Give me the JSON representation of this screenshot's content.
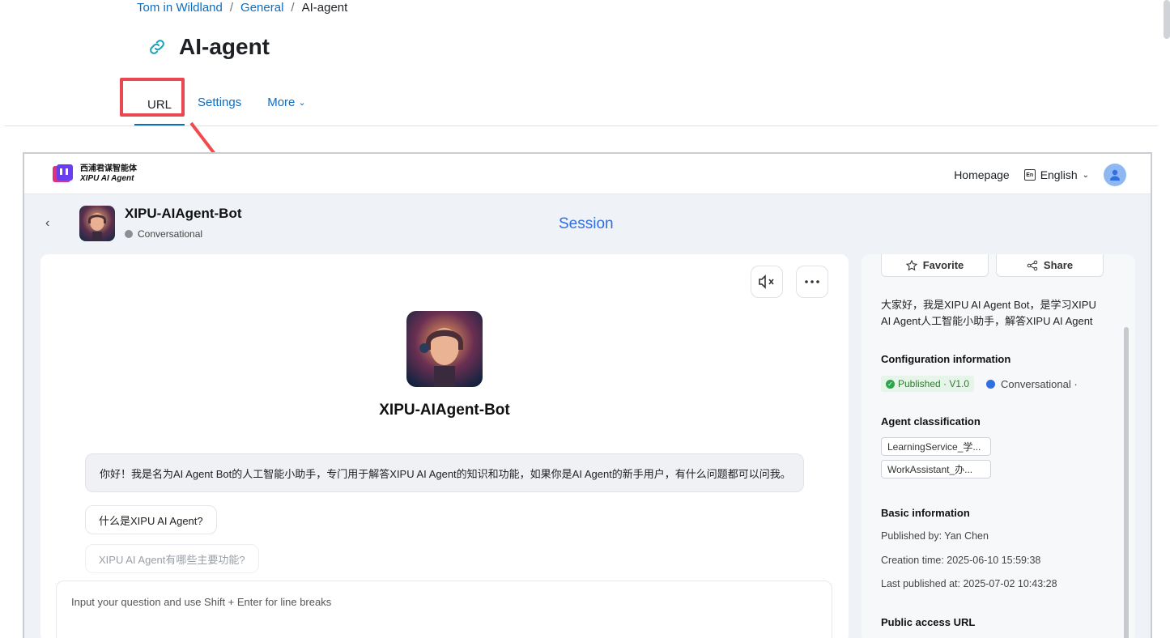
{
  "breadcrumb": {
    "items": [
      "Tom in Wildland",
      "General"
    ],
    "current": "AI-agent",
    "separator": "/"
  },
  "page": {
    "title": "AI-agent",
    "icon": "link-icon"
  },
  "tabs": [
    {
      "label": "URL",
      "active": true
    },
    {
      "label": "Settings",
      "active": false
    },
    {
      "label": "More",
      "active": false,
      "has_dropdown": true
    }
  ],
  "annotation": {
    "highlight_color": "#e8484f"
  },
  "app": {
    "logo": {
      "cn": "西浦君谋智能体",
      "en": "XIPU AI Agent",
      "icon": "xipu-logo-icon"
    },
    "nav": {
      "home": "Homepage",
      "language": "English",
      "language_icon": "language-en-icon",
      "avatar_icon": "user-avatar-icon"
    },
    "bot": {
      "name": "XIPU-AIAgent-Bot",
      "type": "Conversational"
    },
    "session_title": "Session",
    "chat": {
      "bot_name": "XIPU-AIAgent-Bot",
      "greeting": "你好！我是名为AI Agent Bot的人工智能小助手，专门用于解答XIPU AI Agent的知识和功能，如果你是AI Agent的新手用户，有什么问题都可以问我。",
      "suggestions": [
        "什么是XIPU AI Agent?",
        "XIPU AI Agent有哪些主要功能?"
      ],
      "input_placeholder": "Input your question and use Shift + Enter for line breaks"
    },
    "side": {
      "favorite": "Favorite",
      "share": "Share",
      "description": "大家好，我是XIPU AI Agent Bot，是学习XIPU AI Agent人工智能小助手，解答XIPU AI Agent的...",
      "config_title": "Configuration information",
      "published_badge": "Published · V1.0",
      "conversational_badge": "Conversational ·",
      "classification_title": "Agent classification",
      "tags": [
        "LearningService_学...",
        "WorkAssistant_办..."
      ],
      "basic_title": "Basic information",
      "published_by": "Published by: Yan Chen",
      "creation_time": "Creation time: 2025-06-10 15:59:38",
      "last_published": "Last published at: 2025-07-02 10:43:28",
      "public_url_title": "Public access URL"
    },
    "colors": {
      "accent": "#2f6fe0",
      "link": "#0f6cbf",
      "published": "#2e7d32"
    }
  }
}
